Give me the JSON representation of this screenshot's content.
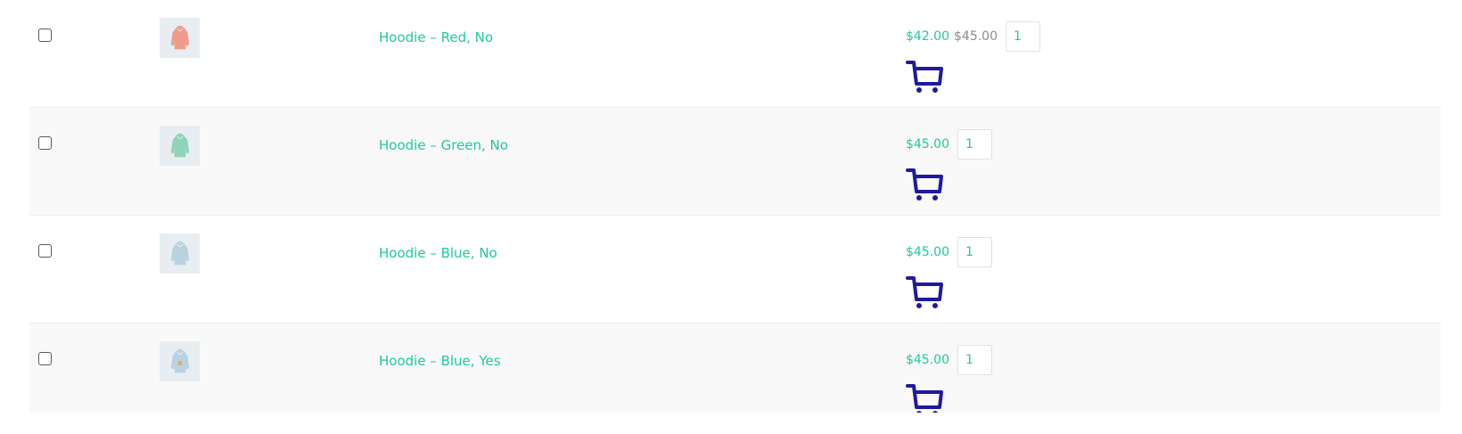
{
  "rows": [
    {
      "name": "Hoodie – Red, No",
      "price": "$42.00",
      "old_price": "$45.00",
      "qty": "1",
      "thumb_color": "#f09a8a"
    },
    {
      "name": "Hoodie – Green, No",
      "price": "$45.00",
      "qty": "1",
      "thumb_color": "#8fd3b8"
    },
    {
      "name": "Hoodie – Blue, No",
      "price": "$45.00",
      "qty": "1",
      "thumb_color": "#b8d2e0"
    },
    {
      "name": "Hoodie – Blue, Yes",
      "price": "$45.00",
      "qty": "1",
      "thumb_color": "#b8d2e0"
    }
  ],
  "colors": {
    "link": "#1ec9a0",
    "old_price": "#8d8d8d",
    "cart_icon": "#1f1a9e",
    "alt_row": "#f9f9f9"
  },
  "icons": {
    "thumbnail": "hoodie-icon",
    "cart": "cart-icon"
  }
}
